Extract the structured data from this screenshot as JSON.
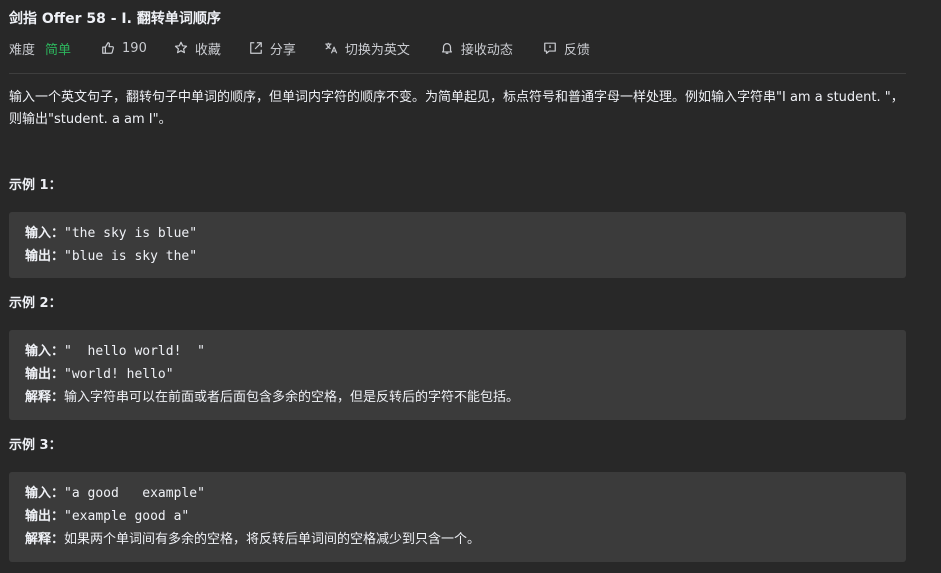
{
  "problem": {
    "title": "剑指 Offer 58 - I. 翻转单词顺序",
    "difficulty_label": "难度",
    "difficulty": "简单",
    "actions": [
      {
        "name": "like",
        "label": "190"
      },
      {
        "name": "favorite",
        "label": "收藏"
      },
      {
        "name": "share",
        "label": "分享"
      },
      {
        "name": "translate",
        "label": "切换为英文"
      },
      {
        "name": "notify",
        "label": "接收动态"
      },
      {
        "name": "feedback",
        "label": "反馈"
      }
    ],
    "description": "输入一个英文句子，翻转句子中单词的顺序，但单词内字符的顺序不变。为简单起见，标点符号和普通字母一样处理。例如输入字符串\"I am a student. \"，则输出\"student. a am I\"。"
  },
  "labels": {
    "input": "输入：",
    "output": "输出：",
    "explanation": "解释："
  },
  "examples": [
    {
      "title": "示例 1：",
      "input": "\"the sky is blue\"",
      "output": "\"blue is sky the\""
    },
    {
      "title": "示例 2：",
      "input": "\"  hello world!  \"",
      "output": "\"world! hello\"",
      "explanation": "输入字符串可以在前面或者后面包含多余的空格，但是反转后的字符不能包括。"
    },
    {
      "title": "示例 3：",
      "input": "\"a good   example\"",
      "output": "\"example good a\"",
      "explanation": "如果两个单词间有多余的空格，将反转后单词间的空格减少到只含一个。"
    }
  ],
  "colors": {
    "background": "#282828",
    "difficulty_easy": "#2db55d",
    "example_box": "#3b3b3b",
    "text": "#eff1f6",
    "muted": "#c9cbd0"
  },
  "icons": [
    "thumbs-up-icon",
    "star-icon",
    "share-icon",
    "translate-icon",
    "bell-icon",
    "feedback-icon"
  ]
}
